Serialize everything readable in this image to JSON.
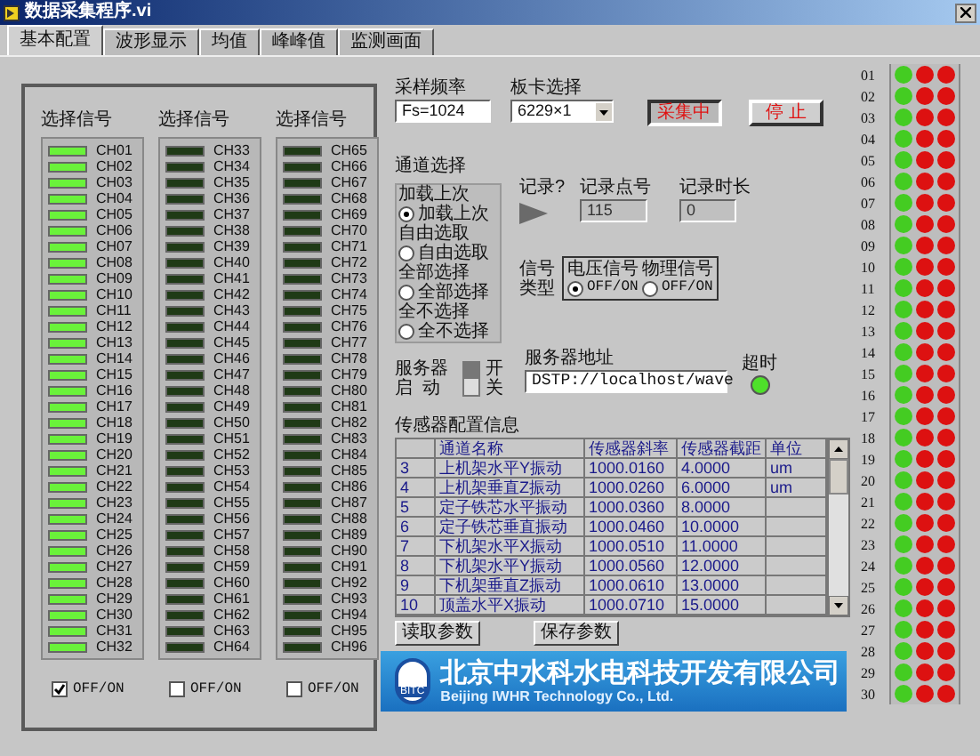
{
  "window": {
    "title": "数据采集程序.vi"
  },
  "tabs": [
    {
      "label": "基本配置",
      "selected": true
    },
    {
      "label": "波形显示",
      "selected": false
    },
    {
      "label": "均值",
      "selected": false
    },
    {
      "label": "峰峰值",
      "selected": false
    },
    {
      "label": "监测画面",
      "selected": false
    }
  ],
  "channel_columns": [
    {
      "header": "选择信号",
      "toggle": {
        "label": "OFF/ON",
        "checked": true
      },
      "channels": [
        {
          "label": "CH01",
          "on": true
        },
        {
          "label": "CH02",
          "on": true
        },
        {
          "label": "CH03",
          "on": true
        },
        {
          "label": "CH04",
          "on": true
        },
        {
          "label": "CH05",
          "on": true
        },
        {
          "label": "CH06",
          "on": true
        },
        {
          "label": "CH07",
          "on": true
        },
        {
          "label": "CH08",
          "on": true
        },
        {
          "label": "CH09",
          "on": true
        },
        {
          "label": "CH10",
          "on": true
        },
        {
          "label": "CH11",
          "on": true
        },
        {
          "label": "CH12",
          "on": true
        },
        {
          "label": "CH13",
          "on": true
        },
        {
          "label": "CH14",
          "on": true
        },
        {
          "label": "CH15",
          "on": true
        },
        {
          "label": "CH16",
          "on": true
        },
        {
          "label": "CH17",
          "on": true
        },
        {
          "label": "CH18",
          "on": true
        },
        {
          "label": "CH19",
          "on": true
        },
        {
          "label": "CH20",
          "on": true
        },
        {
          "label": "CH21",
          "on": true
        },
        {
          "label": "CH22",
          "on": true
        },
        {
          "label": "CH23",
          "on": true
        },
        {
          "label": "CH24",
          "on": true
        },
        {
          "label": "CH25",
          "on": true
        },
        {
          "label": "CH26",
          "on": true
        },
        {
          "label": "CH27",
          "on": true
        },
        {
          "label": "CH28",
          "on": true
        },
        {
          "label": "CH29",
          "on": true
        },
        {
          "label": "CH30",
          "on": true
        },
        {
          "label": "CH31",
          "on": true
        },
        {
          "label": "CH32",
          "on": true
        }
      ]
    },
    {
      "header": "选择信号",
      "toggle": {
        "label": "OFF/ON",
        "checked": false
      },
      "channels": [
        {
          "label": "CH33",
          "on": false
        },
        {
          "label": "CH34",
          "on": false
        },
        {
          "label": "CH35",
          "on": false
        },
        {
          "label": "CH36",
          "on": false
        },
        {
          "label": "CH37",
          "on": false
        },
        {
          "label": "CH38",
          "on": false
        },
        {
          "label": "CH39",
          "on": false
        },
        {
          "label": "CH40",
          "on": false
        },
        {
          "label": "CH41",
          "on": false
        },
        {
          "label": "CH42",
          "on": false
        },
        {
          "label": "CH43",
          "on": false
        },
        {
          "label": "CH44",
          "on": false
        },
        {
          "label": "CH45",
          "on": false
        },
        {
          "label": "CH46",
          "on": false
        },
        {
          "label": "CH47",
          "on": false
        },
        {
          "label": "CH48",
          "on": false
        },
        {
          "label": "CH49",
          "on": false
        },
        {
          "label": "CH50",
          "on": false
        },
        {
          "label": "CH51",
          "on": false
        },
        {
          "label": "CH52",
          "on": false
        },
        {
          "label": "CH53",
          "on": false
        },
        {
          "label": "CH54",
          "on": false
        },
        {
          "label": "CH55",
          "on": false
        },
        {
          "label": "CH56",
          "on": false
        },
        {
          "label": "CH57",
          "on": false
        },
        {
          "label": "CH58",
          "on": false
        },
        {
          "label": "CH59",
          "on": false
        },
        {
          "label": "CH60",
          "on": false
        },
        {
          "label": "CH61",
          "on": false
        },
        {
          "label": "CH62",
          "on": false
        },
        {
          "label": "CH63",
          "on": false
        },
        {
          "label": "CH64",
          "on": false
        }
      ]
    },
    {
      "header": "选择信号",
      "toggle": {
        "label": "OFF/ON",
        "checked": false
      },
      "channels": [
        {
          "label": "CH65",
          "on": false
        },
        {
          "label": "CH66",
          "on": false
        },
        {
          "label": "CH67",
          "on": false
        },
        {
          "label": "CH68",
          "on": false
        },
        {
          "label": "CH69",
          "on": false
        },
        {
          "label": "CH70",
          "on": false
        },
        {
          "label": "CH71",
          "on": false
        },
        {
          "label": "CH72",
          "on": false
        },
        {
          "label": "CH73",
          "on": false
        },
        {
          "label": "CH74",
          "on": false
        },
        {
          "label": "CH75",
          "on": false
        },
        {
          "label": "CH76",
          "on": false
        },
        {
          "label": "CH77",
          "on": false
        },
        {
          "label": "CH78",
          "on": false
        },
        {
          "label": "CH79",
          "on": false
        },
        {
          "label": "CH80",
          "on": false
        },
        {
          "label": "CH81",
          "on": false
        },
        {
          "label": "CH82",
          "on": false
        },
        {
          "label": "CH83",
          "on": false
        },
        {
          "label": "CH84",
          "on": false
        },
        {
          "label": "CH85",
          "on": false
        },
        {
          "label": "CH86",
          "on": false
        },
        {
          "label": "CH87",
          "on": false
        },
        {
          "label": "CH88",
          "on": false
        },
        {
          "label": "CH89",
          "on": false
        },
        {
          "label": "CH90",
          "on": false
        },
        {
          "label": "CH91",
          "on": false
        },
        {
          "label": "CH92",
          "on": false
        },
        {
          "label": "CH93",
          "on": false
        },
        {
          "label": "CH94",
          "on": false
        },
        {
          "label": "CH95",
          "on": false
        },
        {
          "label": "CH96",
          "on": false
        }
      ]
    }
  ],
  "sample_rate": {
    "label": "采样频率",
    "value": "Fs=1024"
  },
  "board_select": {
    "label": "板卡选择",
    "value": "6229×1"
  },
  "buttons": [
    {
      "label": "采集中",
      "pressed": true
    },
    {
      "label": "停 止",
      "pressed": false
    }
  ],
  "channel_select": {
    "label": "通道选择",
    "options": [
      {
        "caption": "加载上次",
        "label": "加载上次",
        "selected": true
      },
      {
        "caption": "自由选取",
        "label": "自由选取",
        "selected": false
      },
      {
        "caption": "全部选择",
        "label": "全部选择",
        "selected": false
      },
      {
        "caption": "全不选择",
        "label": "全不选择",
        "selected": false
      }
    ]
  },
  "record": {
    "label": "记录?",
    "points_label": "记录点号",
    "points": "115",
    "duration_label": "记录时长",
    "duration": "0"
  },
  "signal_type": {
    "label_lines": [
      "信号",
      "类型"
    ],
    "options": [
      {
        "caption": "电压信号",
        "label": "OFF/ON",
        "selected": true
      },
      {
        "caption": "物理信号",
        "label": "OFF/ON",
        "selected": false
      }
    ]
  },
  "server": {
    "label_lines": [
      "服务器",
      "启  动"
    ],
    "on": true,
    "on_label": "开",
    "off_label": "关",
    "address_label": "服务器地址",
    "address": "DSTP://localhost/wave",
    "timeout_label": "超时",
    "timeout_on": true
  },
  "sensor_table": {
    "title": "传感器配置信息",
    "columns": [
      "",
      "通道名称",
      "传感器斜率",
      "传感器截距",
      "单位"
    ],
    "rows": [
      {
        "cells": [
          "3",
          "上机架水平Y振动",
          "1000.0160",
          "4.0000",
          "um"
        ]
      },
      {
        "cells": [
          "4",
          "上机架垂直Z振动",
          "1000.0260",
          "6.0000",
          "um"
        ]
      },
      {
        "cells": [
          "5",
          "定子铁芯水平振动",
          "1000.0360",
          "8.0000"
        ]
      },
      {
        "cells": [
          "6",
          "定子铁芯垂直振动",
          "1000.0460",
          "10.0000"
        ]
      },
      {
        "cells": [
          "7",
          "下机架水平X振动",
          "1000.0510",
          "11.0000"
        ]
      },
      {
        "cells": [
          "8",
          "下机架水平Y振动",
          "1000.0560",
          "12.0000"
        ]
      },
      {
        "cells": [
          "9",
          "下机架垂直Z振动",
          "1000.0610",
          "13.0000"
        ]
      },
      {
        "cells": [
          "10",
          "顶盖水平X振动",
          "1000.0710",
          "15.0000"
        ]
      }
    ]
  },
  "table_buttons": [
    "读取参数",
    "保存参数"
  ],
  "banner": {
    "name": "北京中水科水电科技开发有限公司",
    "name_en": "Beijing IWHR Technology Co., Ltd.",
    "logo_text": "BITC"
  },
  "status_lamps": [
    {
      "label": "01",
      "lamps": [
        {
          "color": "#44cc22"
        },
        {
          "color": "#dd1111"
        },
        {
          "color": "#dd1111"
        }
      ]
    },
    {
      "label": "02",
      "lamps": [
        {
          "color": "#44cc22"
        },
        {
          "color": "#dd1111"
        },
        {
          "color": "#dd1111"
        }
      ]
    },
    {
      "label": "03",
      "lamps": [
        {
          "color": "#44cc22"
        },
        {
          "color": "#dd1111"
        },
        {
          "color": "#dd1111"
        }
      ]
    },
    {
      "label": "04",
      "lamps": [
        {
          "color": "#44cc22"
        },
        {
          "color": "#dd1111"
        },
        {
          "color": "#dd1111"
        }
      ]
    },
    {
      "label": "05",
      "lamps": [
        {
          "color": "#44cc22"
        },
        {
          "color": "#dd1111"
        },
        {
          "color": "#dd1111"
        }
      ]
    },
    {
      "label": "06",
      "lamps": [
        {
          "color": "#44cc22"
        },
        {
          "color": "#dd1111"
        },
        {
          "color": "#dd1111"
        }
      ]
    },
    {
      "label": "07",
      "lamps": [
        {
          "color": "#44cc22"
        },
        {
          "color": "#dd1111"
        },
        {
          "color": "#dd1111"
        }
      ]
    },
    {
      "label": "08",
      "lamps": [
        {
          "color": "#44cc22"
        },
        {
          "color": "#dd1111"
        },
        {
          "color": "#dd1111"
        }
      ]
    },
    {
      "label": "09",
      "lamps": [
        {
          "color": "#44cc22"
        },
        {
          "color": "#dd1111"
        },
        {
          "color": "#dd1111"
        }
      ]
    },
    {
      "label": "10",
      "lamps": [
        {
          "color": "#44cc22"
        },
        {
          "color": "#dd1111"
        },
        {
          "color": "#dd1111"
        }
      ]
    },
    {
      "label": "11",
      "lamps": [
        {
          "color": "#44cc22"
        },
        {
          "color": "#dd1111"
        },
        {
          "color": "#dd1111"
        }
      ]
    },
    {
      "label": "12",
      "lamps": [
        {
          "color": "#44cc22"
        },
        {
          "color": "#dd1111"
        },
        {
          "color": "#dd1111"
        }
      ]
    },
    {
      "label": "13",
      "lamps": [
        {
          "color": "#44cc22"
        },
        {
          "color": "#dd1111"
        },
        {
          "color": "#dd1111"
        }
      ]
    },
    {
      "label": "14",
      "lamps": [
        {
          "color": "#44cc22"
        },
        {
          "color": "#dd1111"
        },
        {
          "color": "#dd1111"
        }
      ]
    },
    {
      "label": "15",
      "lamps": [
        {
          "color": "#44cc22"
        },
        {
          "color": "#dd1111"
        },
        {
          "color": "#dd1111"
        }
      ]
    },
    {
      "label": "16",
      "lamps": [
        {
          "color": "#44cc22"
        },
        {
          "color": "#dd1111"
        },
        {
          "color": "#dd1111"
        }
      ]
    },
    {
      "label": "17",
      "lamps": [
        {
          "color": "#44cc22"
        },
        {
          "color": "#dd1111"
        },
        {
          "color": "#dd1111"
        }
      ]
    },
    {
      "label": "18",
      "lamps": [
        {
          "color": "#44cc22"
        },
        {
          "color": "#dd1111"
        },
        {
          "color": "#dd1111"
        }
      ]
    },
    {
      "label": "19",
      "lamps": [
        {
          "color": "#44cc22"
        },
        {
          "color": "#dd1111"
        },
        {
          "color": "#dd1111"
        }
      ]
    },
    {
      "label": "20",
      "lamps": [
        {
          "color": "#44cc22"
        },
        {
          "color": "#dd1111"
        },
        {
          "color": "#dd1111"
        }
      ]
    },
    {
      "label": "21",
      "lamps": [
        {
          "color": "#44cc22"
        },
        {
          "color": "#dd1111"
        },
        {
          "color": "#dd1111"
        }
      ]
    },
    {
      "label": "22",
      "lamps": [
        {
          "color": "#44cc22"
        },
        {
          "color": "#dd1111"
        },
        {
          "color": "#dd1111"
        }
      ]
    },
    {
      "label": "23",
      "lamps": [
        {
          "color": "#44cc22"
        },
        {
          "color": "#dd1111"
        },
        {
          "color": "#dd1111"
        }
      ]
    },
    {
      "label": "24",
      "lamps": [
        {
          "color": "#44cc22"
        },
        {
          "color": "#dd1111"
        },
        {
          "color": "#dd1111"
        }
      ]
    },
    {
      "label": "25",
      "lamps": [
        {
          "color": "#44cc22"
        },
        {
          "color": "#dd1111"
        },
        {
          "color": "#dd1111"
        }
      ]
    },
    {
      "label": "26",
      "lamps": [
        {
          "color": "#44cc22"
        },
        {
          "color": "#dd1111"
        },
        {
          "color": "#dd1111"
        }
      ]
    },
    {
      "label": "27",
      "lamps": [
        {
          "color": "#44cc22"
        },
        {
          "color": "#dd1111"
        },
        {
          "color": "#dd1111"
        }
      ]
    },
    {
      "label": "28",
      "lamps": [
        {
          "color": "#44cc22"
        },
        {
          "color": "#dd1111"
        },
        {
          "color": "#dd1111"
        }
      ]
    },
    {
      "label": "29",
      "lamps": [
        {
          "color": "#44cc22"
        },
        {
          "color": "#dd1111"
        },
        {
          "color": "#dd1111"
        }
      ]
    },
    {
      "label": "30",
      "lamps": [
        {
          "color": "#44cc22"
        },
        {
          "color": "#dd1111"
        },
        {
          "color": "#dd1111"
        }
      ]
    }
  ]
}
